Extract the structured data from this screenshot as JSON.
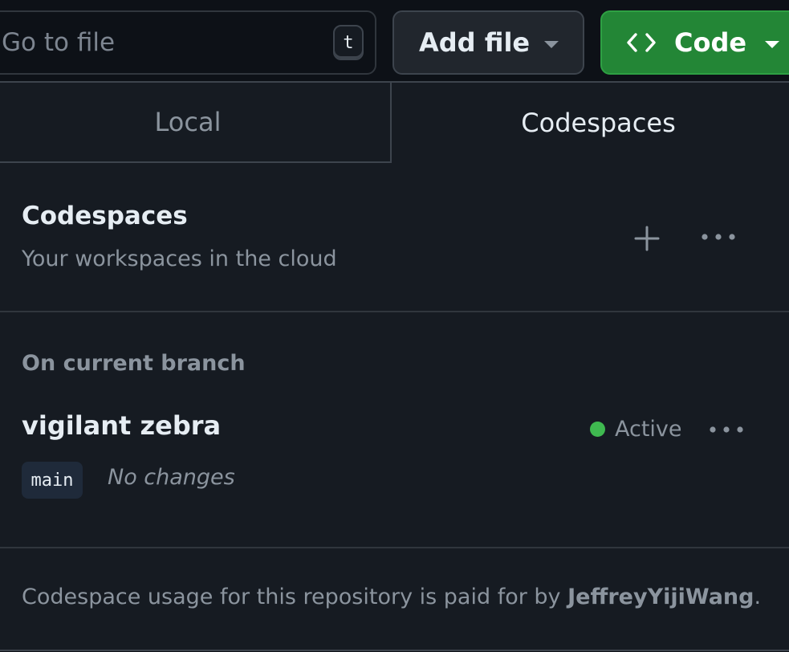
{
  "toolbar": {
    "goto_placeholder": "Go to file",
    "goto_shortcut": "t",
    "add_file_label": "Add file",
    "code_label": "Code"
  },
  "panel": {
    "tabs": [
      {
        "label": "Local",
        "active": false
      },
      {
        "label": "Codespaces",
        "active": true
      }
    ],
    "section_title": "Codespaces",
    "section_subtitle": "Your workspaces in the cloud",
    "branch_group_label": "On current branch",
    "codespace": {
      "name": "vigilant zebra",
      "status": "Active",
      "branch": "main",
      "changes": "No changes"
    },
    "footer": {
      "prefix": "Codespace usage for this repository is paid for by ",
      "user": "JeffreyYijiWang",
      "suffix": "."
    }
  },
  "icons": {
    "code": "code-brackets-icon",
    "add": "plus-icon",
    "more": "kebab-horizontal-icon",
    "status": "status-dot-icon"
  },
  "colors": {
    "background": "#0d1117",
    "panel": "#161b22",
    "primary_button": "#238636",
    "status_active": "#3fb950",
    "muted_text": "#8b949e"
  }
}
